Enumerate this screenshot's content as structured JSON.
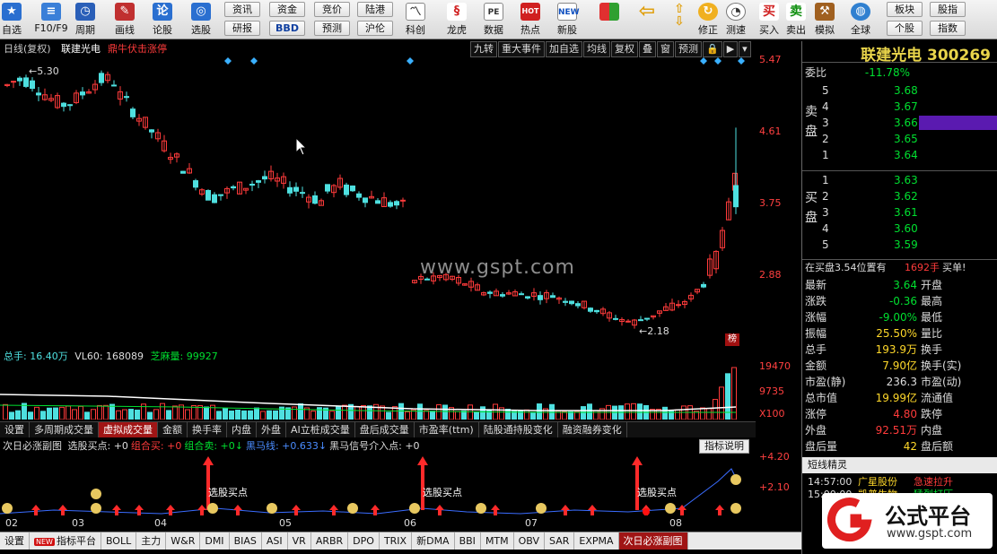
{
  "toolbar": {
    "buttons": [
      {
        "label": "自选",
        "icon": "star-icon"
      },
      {
        "label": "F10/F9",
        "icon": "f10-icon"
      },
      {
        "label": "周期",
        "icon": "clock-icon"
      },
      {
        "label": "画线",
        "icon": "pencil-icon"
      },
      {
        "label": "论股",
        "icon": "forum-icon"
      },
      {
        "label": "选股",
        "icon": "screen-icon"
      },
      {
        "label": "科创",
        "icon": "kechuang-icon"
      },
      {
        "label": "龙虎",
        "icon": "dragon-tiger-icon"
      },
      {
        "label": "数据",
        "icon": "pe-data-icon"
      },
      {
        "label": "热点",
        "icon": "hot-icon"
      },
      {
        "label": "新股",
        "icon": "new-stock-icon"
      },
      {
        "label": "修正",
        "icon": "correction-icon"
      },
      {
        "label": "测速",
        "icon": "speed-test-icon"
      },
      {
        "label": "买入",
        "icon": "buy-icon"
      },
      {
        "label": "卖出",
        "icon": "sell-icon"
      },
      {
        "label": "模拟",
        "icon": "simulate-icon"
      },
      {
        "label": "全球",
        "icon": "globe-icon"
      }
    ],
    "row_buttons": {
      "r1": [
        "资讯",
        "资金",
        "竞价",
        "陆港"
      ],
      "r2": [
        "研报",
        "BBD",
        "预测",
        "沪伦"
      ]
    },
    "right_buttons": {
      "r1": [
        "板块",
        "股指"
      ],
      "r2": [
        "个股",
        "指数"
      ]
    }
  },
  "chart": {
    "period_label": "日线(复权)",
    "stock_name": "联建光电",
    "signal_text": "鼎牛伏击涨停",
    "buttons": [
      "九转",
      "重大事件",
      "加自选",
      "均线",
      "复权",
      "叠",
      "窗",
      "预测"
    ],
    "y_labels": [
      "5.47",
      "4.61",
      "3.75",
      "2.88"
    ],
    "high_annotation": "5.30",
    "low_annotation": "2.18",
    "watermark": "www.gspt.com",
    "bang": "榜"
  },
  "volume": {
    "total": "总手: 16.40万",
    "vl60": "VL60: 168089",
    "zhima": "芝麻量: 99927",
    "y_labels": [
      "19470",
      "9735",
      "X100"
    ]
  },
  "tabs": [
    "设置",
    "多周期成交量",
    "虚拟成交量",
    "金额",
    "换手率",
    "内盘",
    "外盘",
    "AI立桩成交量",
    "盘后成交量",
    "市盈率(ttm)",
    "陆股通持股变化",
    "融资融券变化"
  ],
  "active_tab": "虚拟成交量",
  "indicator": {
    "name": "次日必涨副图",
    "items": [
      {
        "text": "选股买点: +0",
        "color": "#dddddd"
      },
      {
        "text": "组合买: +0",
        "color": "#ff3b3b"
      },
      {
        "text": "组合卖: +0↓",
        "color": "#00e030"
      },
      {
        "text": "黑马线: +0.633↓",
        "color": "#4a8cff"
      },
      {
        "text": "黑马信号介入点: +0",
        "color": "#dddddd"
      }
    ],
    "button": "指标说明",
    "y_labels": [
      "+4.20",
      "+2.10"
    ],
    "buy_labels": [
      "选股买点",
      "选股买点",
      "选股买点"
    ]
  },
  "date_axis": [
    "02",
    "03",
    "04",
    "05",
    "06",
    "07",
    "08"
  ],
  "bottom_tabs": [
    "设置",
    "指标平台",
    "BOLL",
    "主力",
    "W&R",
    "DMI",
    "BIAS",
    "ASI",
    "VR",
    "ARBR",
    "DPO",
    "TRIX",
    "新DMA",
    "BBI",
    "MTM",
    "OBV",
    "SAR",
    "EXPMA",
    "次日必涨副图"
  ],
  "bottom_new_badge": "NEW",
  "bottom_active": "次日必涨副图",
  "quote": {
    "name": "联建光电",
    "code": "300269",
    "weibi_label": "委比",
    "weibi": "-11.78%",
    "sell_label": "卖盘",
    "buy_label": "买盘",
    "sells": [
      {
        "n": "5",
        "p": "3.68"
      },
      {
        "n": "4",
        "p": "3.67"
      },
      {
        "n": "3",
        "p": "3.66"
      },
      {
        "n": "2",
        "p": "3.65"
      },
      {
        "n": "1",
        "p": "3.64"
      }
    ],
    "buys": [
      {
        "n": "1",
        "p": "3.63"
      },
      {
        "n": "2",
        "p": "3.62"
      },
      {
        "n": "3",
        "p": "3.61"
      },
      {
        "n": "4",
        "p": "3.60"
      },
      {
        "n": "5",
        "p": "3.59"
      }
    ],
    "buying_note": "在买盘3.54位置有",
    "buying_amount": "1692手",
    "buying_tag": "买单!",
    "stats": [
      {
        "l": "最新",
        "v": "3.64",
        "vc": "g",
        "l2": "开盘"
      },
      {
        "l": "涨跌",
        "v": "-0.36",
        "vc": "g",
        "l2": "最高"
      },
      {
        "l": "涨幅",
        "v": "-9.00%",
        "vc": "g",
        "l2": "最低"
      },
      {
        "l": "振幅",
        "v": "25.50%",
        "vc": "y",
        "l2": "量比"
      },
      {
        "l": "总手",
        "v": "193.9万",
        "vc": "y",
        "l2": "换手"
      },
      {
        "l": "金额",
        "v": "7.90亿",
        "vc": "y",
        "l2": "换手(实)"
      },
      {
        "l": "市盈(静)",
        "v": "236.3",
        "vc": "w",
        "l2": "市盈(动)"
      },
      {
        "l": "总市值",
        "v": "19.99亿",
        "vc": "y",
        "l2": "流通值"
      },
      {
        "l": "涨停",
        "v": "4.80",
        "vc": "r",
        "l2": "跌停"
      },
      {
        "l": "外盘",
        "v": "92.51万",
        "vc": "r",
        "l2": "内盘"
      },
      {
        "l": "盘后量",
        "v": "42",
        "vc": "y",
        "l2": "盘后额"
      }
    ],
    "short_title": "短线精灵",
    "short_items": [
      {
        "t": "14:57:00",
        "n": "广星股份",
        "e": "急速拉升"
      },
      {
        "t": "15:00:00",
        "n": "凯普生物",
        "e": "猛烈打压"
      }
    ]
  },
  "logo": {
    "text": "公式平台",
    "url": "www.gspt.com"
  },
  "colors": {
    "up": "#ff3b3b",
    "down": "#4ee0e0",
    "bg": "#000000",
    "accent": "#a01515",
    "quote_name": "#e8d44a"
  }
}
